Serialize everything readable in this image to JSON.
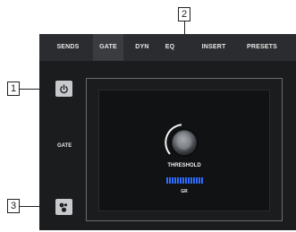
{
  "tabs": [
    {
      "label": "SENDS",
      "active": false
    },
    {
      "label": "GATE",
      "active": true
    },
    {
      "label": "DYN",
      "active": false
    },
    {
      "label": "EQ",
      "active": false
    },
    {
      "label": "INSERT",
      "active": false
    },
    {
      "label": "PRESETS",
      "active": false
    }
  ],
  "side": {
    "power_icon": "power-icon",
    "gate_label": "GATE",
    "key_icon": "key-filter-icon"
  },
  "knob": {
    "label": "THRESHOLD",
    "meter_label": "GR"
  },
  "callouts": {
    "one": "1",
    "two": "2",
    "three": "3"
  },
  "colors": {
    "accent": "#2f6bff",
    "active_tab": "#3b3c40",
    "background": "#1b1c1e"
  }
}
